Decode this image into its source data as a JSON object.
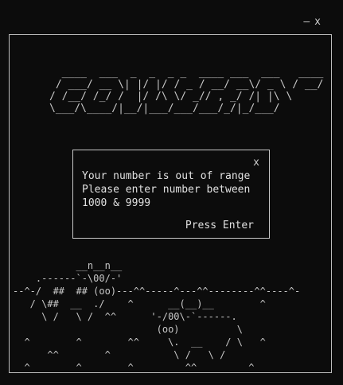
{
  "window": {
    "minimize_label": "—",
    "close_label": "x"
  },
  "logo_art": "  ____  ___  _  _  _ _  ____ ___  ___   ____\n / ___/ __ \\| |/ |/ / _ / __/ __\\/ _ \\ / __/\n/ /__/ /_/ /  |/ /\\ \\/ _// , _/ /| |\\ \\\n\\___/\\____/|__/|___/___/___/_/|_/___/",
  "dialog": {
    "close_label": "x",
    "line1": "Your number is out of range",
    "line2": "Please enter number between",
    "line3": "1000 & 9999",
    "enter_label": "Press Enter"
  },
  "scene_art": "           __n__n__\n    .------`-\\00/-'\n--^-/  ##  ## (oo)---^^-----^---^^--------^^----^-\n   / \\##  __  ./    ^      __(__)__        ^\n     \\ /   \\ /  ^^      '-/00\\-`------.\n                         (oo)          \\\n  ^        ^        ^^     \\.  __    / \\   ^\n      ^^        ^           \\ /   \\ /\n  ^        ^        ^         ^^         ^"
}
